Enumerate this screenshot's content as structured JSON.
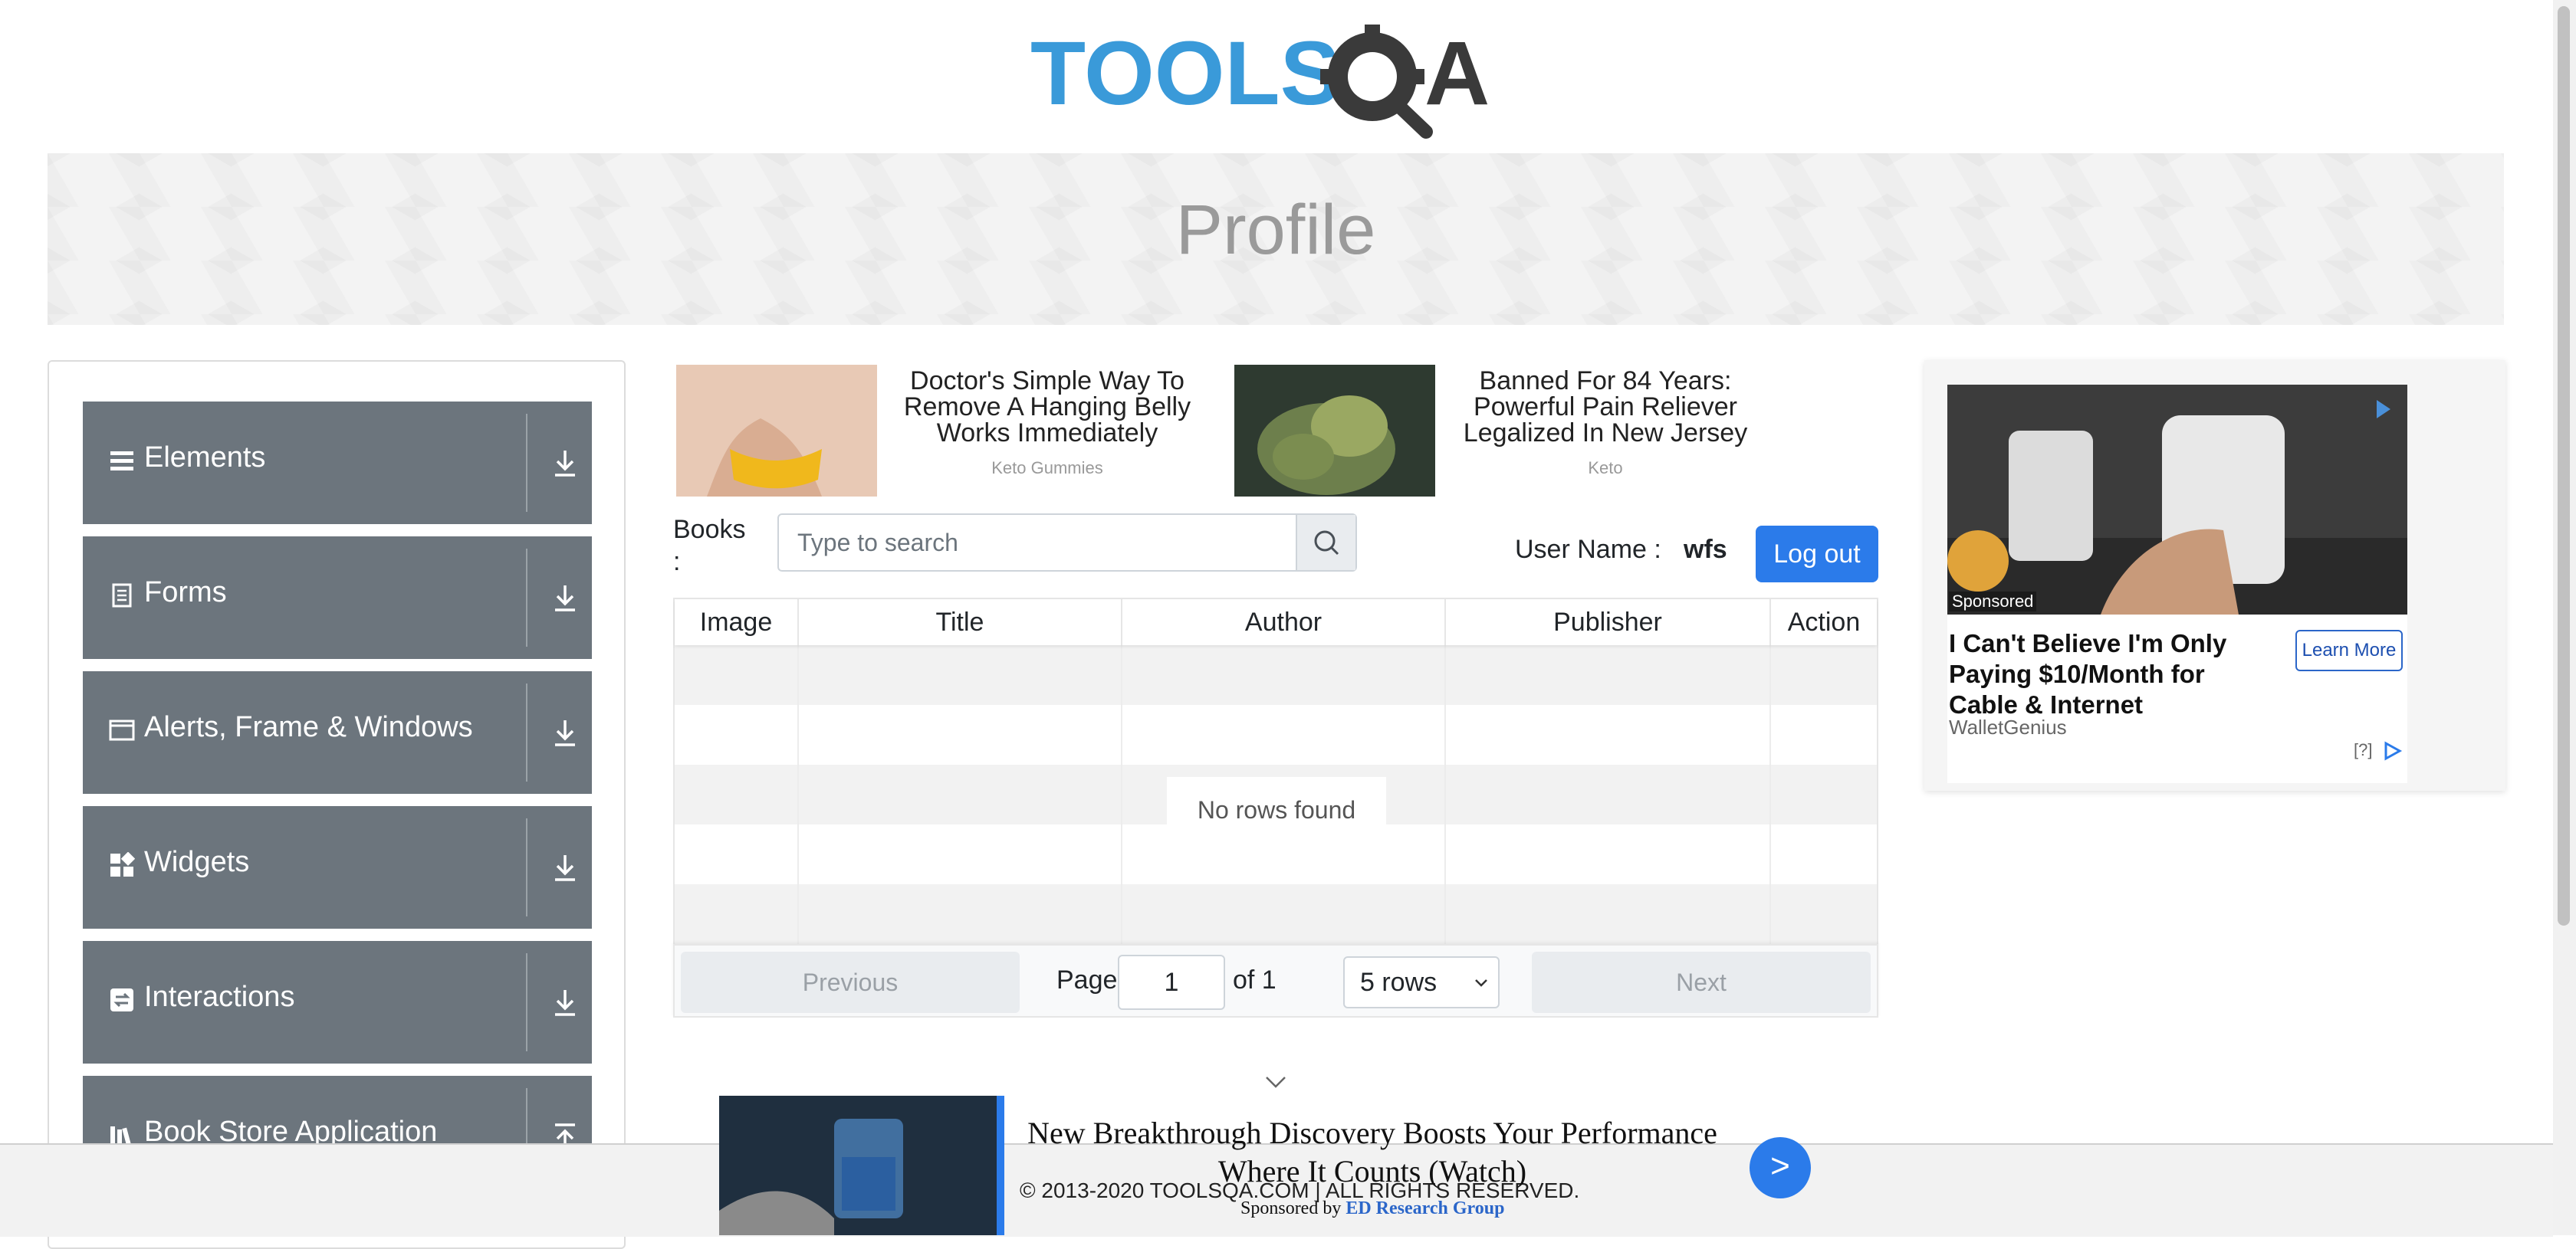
{
  "logo": {
    "text_blue": "TOOLS",
    "text_dark": "QA"
  },
  "banner": {
    "title": "Profile"
  },
  "sidebar": {
    "groups": [
      {
        "label": "Elements",
        "icon": "menu-icon"
      },
      {
        "label": "Forms",
        "icon": "document-icon"
      },
      {
        "label": "Alerts, Frame & Windows",
        "icon": "window-icon"
      },
      {
        "label": "Widgets",
        "icon": "widgets-icon"
      },
      {
        "label": "Interactions",
        "icon": "interactions-icon"
      },
      {
        "label": "Book Store Application",
        "icon": "bookstore-icon"
      }
    ]
  },
  "ads": [
    {
      "title": "Doctor's Simple Way To Remove A Hanging Belly Works Immediately",
      "source": "Keto Gummies"
    },
    {
      "title": "Banned For 84 Years: Powerful Pain Reliever Legalized In New Jersey",
      "source": "Keto"
    }
  ],
  "books": {
    "label": "Books :",
    "search_placeholder": "Type to search",
    "search_value": ""
  },
  "user": {
    "label": "User Name :",
    "value": "wfs",
    "logout_label": "Log out"
  },
  "table": {
    "columns": [
      "Image",
      "Title",
      "Author",
      "Publisher",
      "Action"
    ],
    "empty_text": "No rows found",
    "pagination": {
      "previous_label": "Previous",
      "next_label": "Next",
      "page_label": "Page",
      "page_value": "1",
      "of_label": "of 1",
      "rows_selected": "5 rows"
    }
  },
  "right_ad": {
    "sponsored": "Sponsored",
    "title": "I Can't Believe I'm Only Paying $10/Month for Cable & Internet",
    "source": "WalletGenius",
    "learn_more": "Learn More",
    "help": "[?]"
  },
  "bottom_ad": {
    "title": "New Breakthrough Discovery Boosts Your Performance Where It Counts (Watch)",
    "sponsored_by": "Sponsored by",
    "sponsor": "ED Research Group",
    "go_label": ">"
  },
  "footer": {
    "text": "© 2013-2020 TOOLSQA.COM | ALL RIGHTS RESERVED."
  },
  "colors": {
    "primary": "#2b7bea",
    "sidebar_group": "#6c757d",
    "logo_blue": "#3a9ad9",
    "logo_dark": "#3a3a3a"
  }
}
